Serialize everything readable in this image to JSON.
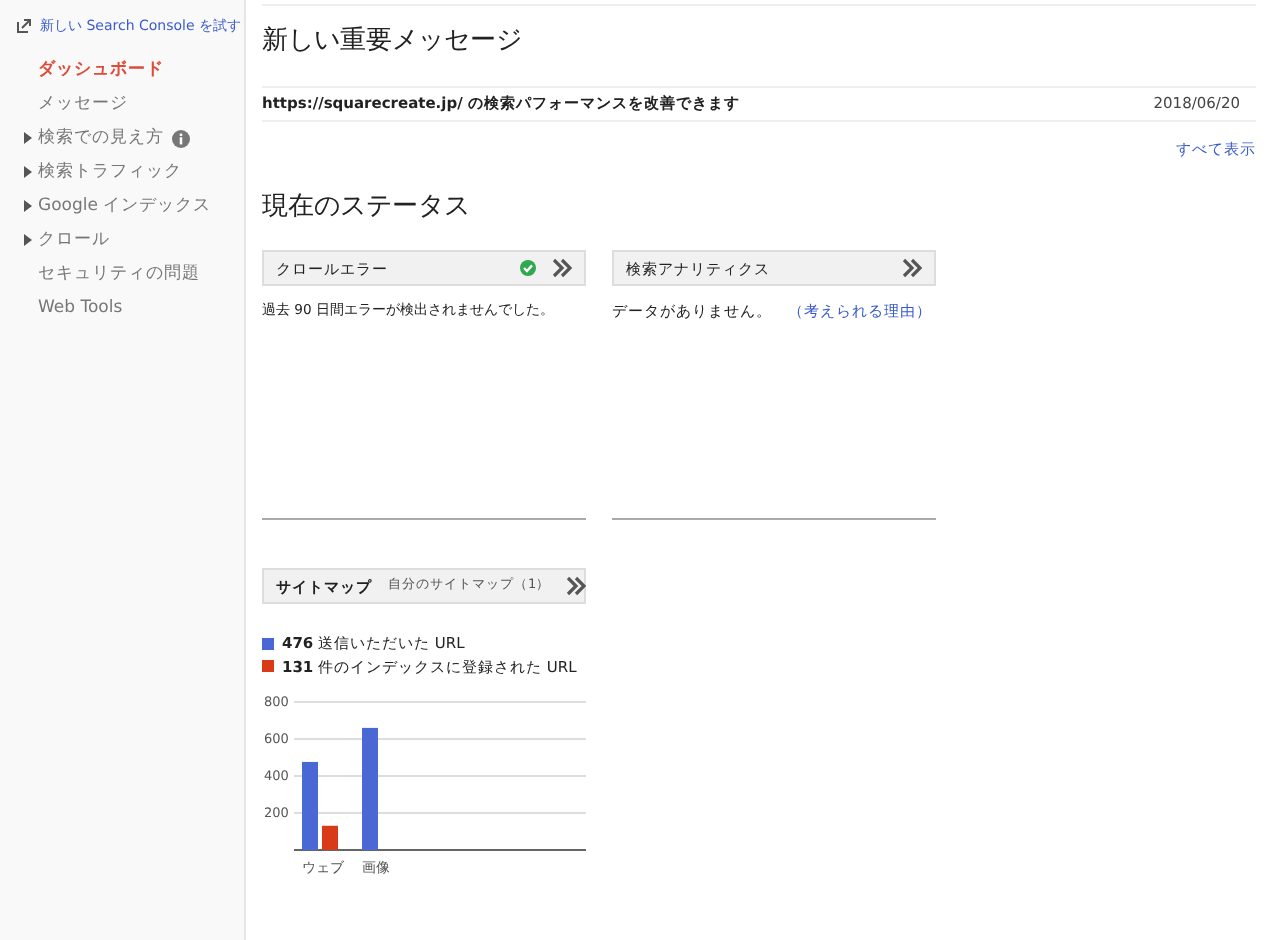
{
  "sidebar": {
    "try_link": "新しい Search Console を試す",
    "items": [
      {
        "label": "ダッシュボード",
        "selected": true,
        "expandable": false,
        "info": false
      },
      {
        "label": "メッセージ",
        "selected": false,
        "expandable": false,
        "info": false
      },
      {
        "label": "検索での見え方",
        "selected": false,
        "expandable": true,
        "info": true
      },
      {
        "label": "検索トラフィック",
        "selected": false,
        "expandable": true,
        "info": false
      },
      {
        "label": "Google インデックス",
        "selected": false,
        "expandable": true,
        "info": false
      },
      {
        "label": "クロール",
        "selected": false,
        "expandable": true,
        "info": false
      },
      {
        "label": "セキュリティの問題",
        "selected": false,
        "expandable": false,
        "info": false
      },
      {
        "label": "Web Tools",
        "selected": false,
        "expandable": false,
        "info": false
      }
    ]
  },
  "messages": {
    "title": "新しい重要メッセージ",
    "items": [
      {
        "text": "https://squarecreate.jp/ の検索パフォーマンスを改善できます",
        "date": "2018/06/20"
      }
    ],
    "show_all": "すべて表示"
  },
  "status": {
    "title": "現在のステータス",
    "crawl_errors": {
      "title": "クロールエラー",
      "ok": true,
      "text": "過去 90 日間エラーが検出されませんでした。"
    },
    "search_analytics": {
      "title": "検索アナリティクス",
      "text": "データがありません。",
      "link": "（考えられる理由）"
    },
    "sitemaps": {
      "title": "サイトマップ",
      "link": "自分のサイトマップ（1）",
      "legend": [
        {
          "text": "**476** 送信いただいた URL",
          "color": "#4a68d4"
        },
        {
          "text": "**131** 件のインデックスに登録された URL",
          "color": "#d83b17"
        }
      ],
      "chart_data": {
        "type": "bar",
        "categories": [
          "ウェブ",
          "画像"
        ],
        "series": [
          {
            "color": "#4a68d4",
            "values": [
              476,
              660
            ]
          },
          {
            "color": "#d83b17",
            "values": [
              131,
              null
            ]
          }
        ],
        "ylim": [
          0,
          800
        ],
        "yticks": [
          200,
          400,
          600,
          800
        ],
        "grid": true
      }
    }
  }
}
